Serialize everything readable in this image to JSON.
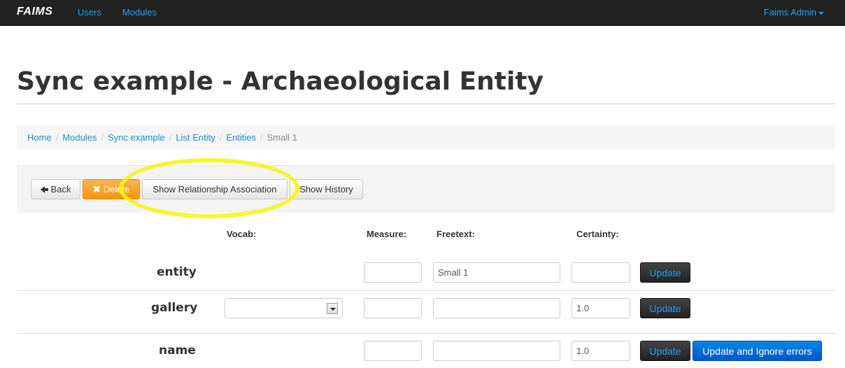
{
  "navbar": {
    "brand": "FAIMS",
    "links": [
      "Users",
      "Modules"
    ],
    "user": "Faims Admin"
  },
  "page": {
    "title": "Sync example - Archaeological Entity"
  },
  "breadcrumb": {
    "items": [
      "Home",
      "Modules",
      "Sync example",
      "List Entity",
      "Entities"
    ],
    "active": "Small 1"
  },
  "toolbar": {
    "back": "Back",
    "delete": "Delete",
    "relationship": "Show Relationship Association",
    "history": "Show History"
  },
  "columns": {
    "vocab": "Vocab:",
    "measure": "Measure:",
    "freetext": "Freetext:",
    "certainty": "Certainty:"
  },
  "rows": [
    {
      "label": "entity",
      "vocab": "",
      "measure": "",
      "freetext": "Small 1",
      "certainty": "",
      "update": "Update"
    },
    {
      "label": "gallery",
      "vocab": "",
      "measure": "",
      "freetext": "",
      "certainty": "1.0",
      "update": "Update"
    },
    {
      "label": "name",
      "vocab": "",
      "measure": "",
      "freetext": "",
      "certainty": "1.0",
      "update": "Update",
      "update_ignore": "Update and Ignore errors"
    }
  ],
  "colors": {
    "navbar": "#222222",
    "link": "#1da1f2",
    "delete": "#f89406",
    "highlight": "#f5f516",
    "primary": "#0066cc"
  }
}
